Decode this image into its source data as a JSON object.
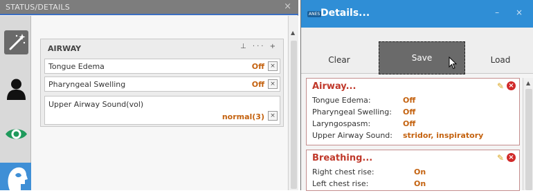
{
  "left_panel": {
    "title": "STATUS/DETAILS",
    "close": "×",
    "rail_icons": [
      "wand-icon",
      "person-icon",
      "eye-icon",
      "head-profile-icon"
    ],
    "section": {
      "title": "AIRWAY",
      "tools": "⊥ ··· +",
      "rows": [
        {
          "label": "Tongue Edema",
          "value": "Off",
          "remove": "×"
        },
        {
          "label": "Pharyngeal Swelling",
          "value": "Off",
          "remove": "×"
        },
        {
          "label": "Upper Airway Sound(vol)",
          "value": "normal(3)",
          "remove": "×"
        }
      ]
    }
  },
  "right_panel": {
    "title": "Details...",
    "badge": "ANES",
    "window_controls": "– ×",
    "toolbar": {
      "clear": "Clear",
      "save": "Save",
      "load": "Load"
    },
    "cards": [
      {
        "title": "Airway...",
        "items": [
          {
            "label": "Tongue Edema:",
            "value": "Off"
          },
          {
            "label": "Pharyngeal Swelling:",
            "value": "Off"
          },
          {
            "label": "Laryngospasm:",
            "value": "Off"
          },
          {
            "label": "Upper Airway Sound:",
            "value": "stridor, inspiratory"
          }
        ]
      },
      {
        "title": "Breathing...",
        "items": [
          {
            "label": "Right chest rise:",
            "value": "On"
          },
          {
            "label": "Left chest rise:",
            "value": "On"
          }
        ]
      }
    ]
  },
  "colors": {
    "accent": "#2f8ed6",
    "value": "#c4620f",
    "card_title": "#c0392b"
  }
}
